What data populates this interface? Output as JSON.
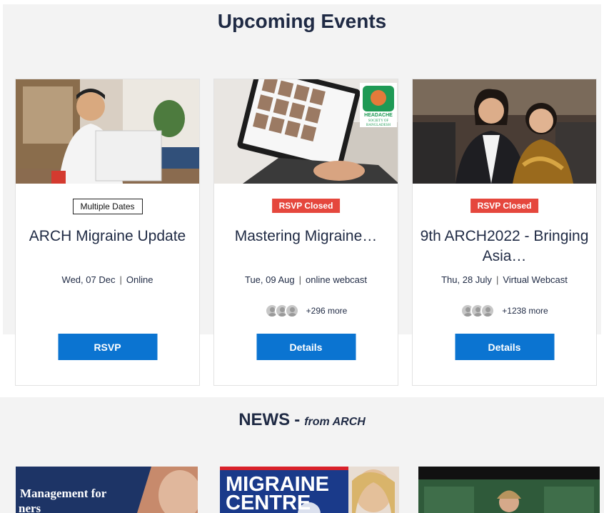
{
  "events": {
    "title": "Upcoming Events",
    "cards": [
      {
        "badge": "Multiple Dates",
        "title": "ARCH Migraine Update",
        "date": "Wed, 07 Dec",
        "location": "Online",
        "attendees_more": "",
        "button": "RSVP"
      },
      {
        "badge": "RSVP Closed",
        "title": "Mastering Migraine…",
        "date": "Tue, 09 Aug",
        "location": "online webcast",
        "attendees_more": "+296 more",
        "button": "Details",
        "logo_text": [
          "HEADACHE",
          "SOCIETY OF",
          "BANGLADESH"
        ]
      },
      {
        "badge": "RSVP Closed",
        "title": "9th ARCH2022 - Bringing Asia…",
        "date": "Thu, 28 July",
        "location": "Virtual Webcast",
        "attendees_more": "+1238 more",
        "button": "Details"
      }
    ]
  },
  "news": {
    "title": "NEWS",
    "dash": "-",
    "subtitle": "from ARCH",
    "items": [
      {
        "text_line1": "Management for",
        "text_line2": "ners"
      },
      {
        "text_line1": "MIGRAINE",
        "text_line2": "CENTRE"
      },
      {
        "text_line1": "",
        "text_line2": ""
      }
    ]
  },
  "colors": {
    "primary_button": "#0b74d1",
    "closed_badge": "#e5473d",
    "heading": "#1f2a44",
    "section_bg": "#f3f3f3"
  },
  "icons": [
    "avatar-icon"
  ]
}
